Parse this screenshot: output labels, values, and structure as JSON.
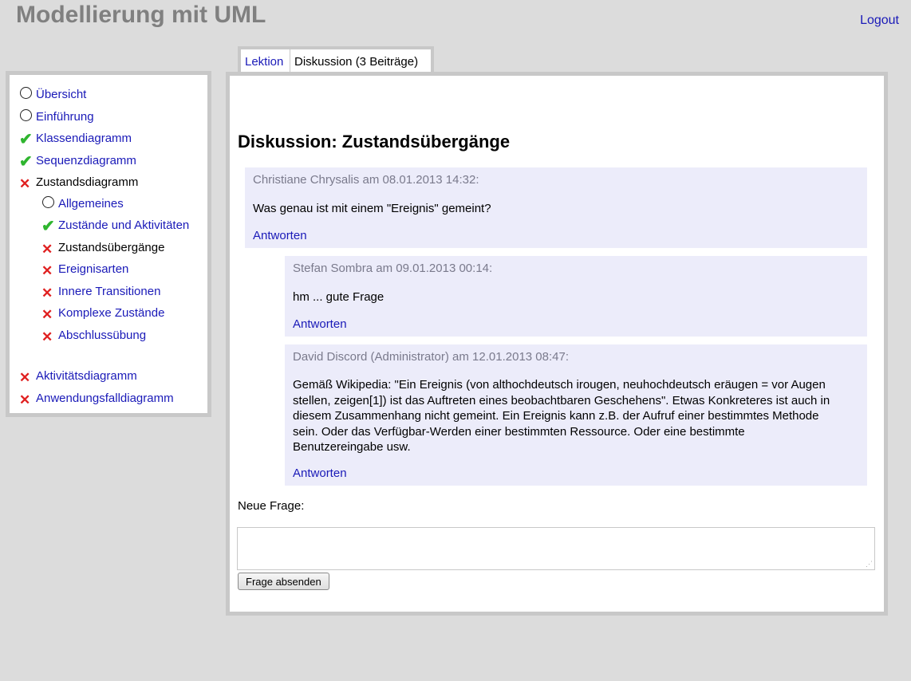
{
  "app": {
    "title": "Modellierung mit UML",
    "logout_label": "Logout"
  },
  "sidebar": {
    "items": [
      {
        "label": "Übersicht",
        "status": "open"
      },
      {
        "label": "Einführung",
        "status": "open"
      },
      {
        "label": "Klassendiagramm",
        "status": "done"
      },
      {
        "label": "Sequenzdiagramm",
        "status": "done"
      },
      {
        "label": "Zustandsdiagramm",
        "status": "todo"
      },
      {
        "label": "Allgemeines",
        "status": "open"
      },
      {
        "label": "Zustände und Aktivitäten",
        "status": "done"
      },
      {
        "label": "Zustandsübergänge",
        "status": "todo"
      },
      {
        "label": "Ereignisarten",
        "status": "todo"
      },
      {
        "label": "Innere Transitionen",
        "status": "todo"
      },
      {
        "label": "Komplexe Zustände",
        "status": "todo"
      },
      {
        "label": "Abschlussübung",
        "status": "todo"
      },
      {
        "label": "Aktivitätsdiagramm",
        "status": "todo"
      },
      {
        "label": "Anwendungsfalldiagramm",
        "status": "todo"
      }
    ]
  },
  "tabs": [
    {
      "label": "Lektion",
      "active": false
    },
    {
      "label": "Diskussion (3 Beiträge)",
      "active": true
    }
  ],
  "discussion": {
    "title": "Diskussion: Zustandsübergänge",
    "posts": [
      {
        "header": "Christiane Chrysalis am 08.01.2013 14:32:",
        "body": "Was genau ist mit einem \"Ereignis\" gemeint?",
        "reply_label": "Antworten"
      },
      {
        "header": "Stefan Sombra am 09.01.2013 00:14:",
        "body": "hm ... gute Frage",
        "reply_label": "Antworten"
      },
      {
        "header": "David Discord (Administrator) am 12.01.2013 08:47:",
        "body_lines": [
          "Gemäß Wikipedia: \"Ein Ereignis (von althochdeutsch irougen, neuhochdeutsch eräugen = vor Augen",
          "stellen, zeigen[1]) ist das Auftreten eines beobachtbaren Geschehens\". Etwas Konkreteres ist auch in",
          "diesem Zusammenhang nicht gemeint. Ein Ereignis kann z.B. der Aufruf einer bestimmtes Methode",
          "sein. Oder das Verfügbar-Werden einer bestimmten Ressource. Oder eine bestimmte",
          "Benutzereingabe usw."
        ],
        "reply_label": "Antworten"
      }
    ],
    "new_question_label": "Neue Frage:",
    "new_question_value": "",
    "submit_label": "Frage absenden"
  },
  "colors": {
    "page_bg": "#dcdcdc",
    "link": "#1a1ab8",
    "post_bg": "#ececfa",
    "check": "#2fb52f",
    "cross": "#e02020",
    "title_gray": "#808080"
  }
}
